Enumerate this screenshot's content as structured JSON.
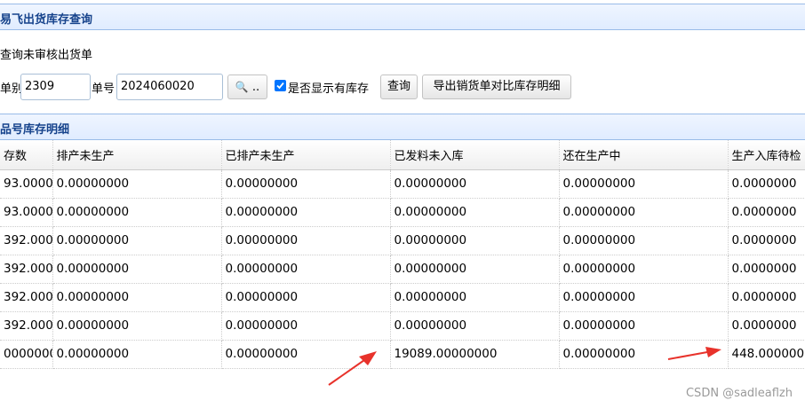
{
  "header1": {
    "title": "易飞出货库存查询"
  },
  "subtitle": "查询未审核出货单",
  "toolbar": {
    "type_label": "单别",
    "type_value": "2309",
    "number_label": "单号",
    "number_value": "2024060020",
    "search_icon_label": "..",
    "show_stock_label": "是否显示有库存",
    "show_stock_checked": true,
    "query_label": "查询",
    "export_label": "导出销货单对比库存明细"
  },
  "header2": {
    "title": "品号库存明细"
  },
  "table": {
    "columns": [
      "存数",
      "排产未生产",
      "已排产未生产",
      "已发料未入库",
      "还在生产中",
      "生产入库待检"
    ],
    "rows": [
      [
        "93.0000",
        "0.00000000",
        "0.00000000",
        "0.00000000",
        "0.00000000",
        "0.0000000"
      ],
      [
        "93.0000",
        "0.00000000",
        "0.00000000",
        "0.00000000",
        "0.00000000",
        "0.0000000"
      ],
      [
        "392.000",
        "0.00000000",
        "0.00000000",
        "0.00000000",
        "0.00000000",
        "0.0000000"
      ],
      [
        "392.000",
        "0.00000000",
        "0.00000000",
        "0.00000000",
        "0.00000000",
        "0.0000000"
      ],
      [
        "392.000",
        "0.00000000",
        "0.00000000",
        "0.00000000",
        "0.00000000",
        "0.0000000"
      ],
      [
        "392.000",
        "0.00000000",
        "0.00000000",
        "0.00000000",
        "0.00000000",
        "0.0000000"
      ],
      [
        "0000000",
        "0.00000000",
        "0.00000000",
        "19089.00000000",
        "0.00000000",
        "448.000000"
      ]
    ]
  },
  "watermark": "CSDN @sadleaflzh",
  "colors": {
    "header_text": "#15428b",
    "arrow": "#e8322b"
  }
}
